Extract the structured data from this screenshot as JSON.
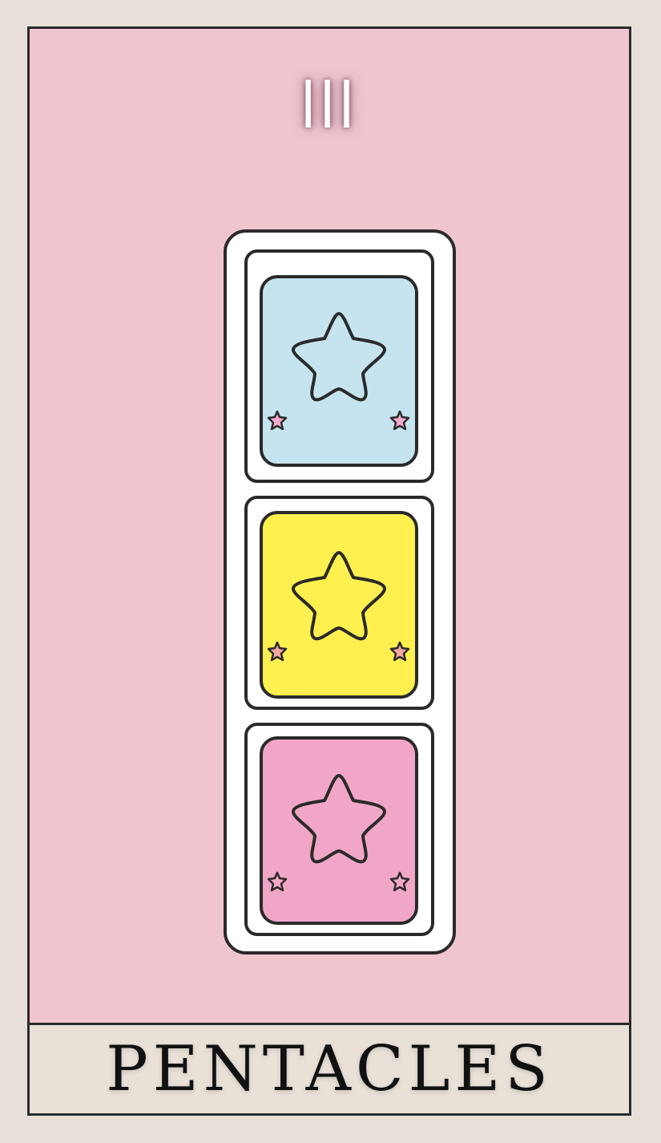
{
  "card": {
    "numeral": "III",
    "title": "PENTACLES"
  },
  "colors": {
    "background": "#e8e0d8",
    "card_pink": "#f1c5d0",
    "outline": "#2a2a2a",
    "panel_blue": "#c5e4ef",
    "panel_yellow": "#fff04f",
    "panel_pink": "#f2a6c7",
    "small_star_pink": "#f5a9cc",
    "small_star_orange": "#f6a8a0"
  },
  "panels": [
    {
      "color": "panel_blue",
      "icon": "star-icon"
    },
    {
      "color": "panel_yellow",
      "icon": "star-icon"
    },
    {
      "color": "panel_pink",
      "icon": "star-icon"
    }
  ]
}
